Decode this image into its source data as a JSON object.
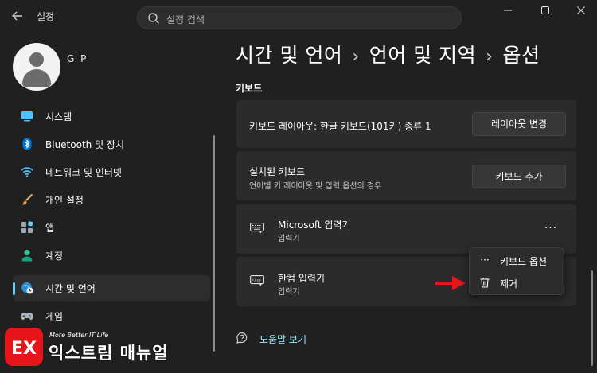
{
  "window": {
    "app_title": "설정",
    "back_icon": "back-arrow-icon",
    "controls": [
      "minimize-icon",
      "maximize-icon",
      "close-icon"
    ]
  },
  "search": {
    "placeholder": "설정 검색",
    "icon": "search-icon"
  },
  "user": {
    "name": "G P"
  },
  "sidebar": {
    "items": [
      {
        "label": "시스템",
        "icon": "system-icon",
        "selected": false
      },
      {
        "label": "Bluetooth 및 장치",
        "icon": "bluetooth-icon",
        "selected": false
      },
      {
        "label": "네트워크 및 인터넷",
        "icon": "wifi-icon",
        "selected": false
      },
      {
        "label": "개인 설정",
        "icon": "brush-icon",
        "selected": false
      },
      {
        "label": "앱",
        "icon": "apps-icon",
        "selected": false
      },
      {
        "label": "계정",
        "icon": "account-icon",
        "selected": false
      },
      {
        "label": "시간 및 언어",
        "icon": "globe-clock-icon",
        "selected": true
      },
      {
        "label": "게임",
        "icon": "gamepad-icon",
        "selected": false
      }
    ]
  },
  "breadcrumb": {
    "part1": "시간 및 언어",
    "part2": "언어 및 지역",
    "part3": "옵션",
    "separator": "›"
  },
  "section": {
    "title": "키보드"
  },
  "cards": {
    "layout": {
      "label": "키보드 레이아웃: 한글 키보드(101키) 종류 1",
      "button": "레이아웃 변경"
    },
    "installed": {
      "label": "설치된 키보드",
      "sub": "언어별 키 레이아웃 및 입력 옵션의 경우",
      "button": "키보드 추가"
    },
    "microsoft_ime": {
      "label": "Microsoft 입력기",
      "sub": "입력기",
      "more": "···"
    },
    "hancom_ime": {
      "label": "한컴 입력기",
      "sub": "입력기"
    }
  },
  "context_menu": {
    "items": [
      {
        "label": "키보드 옵션",
        "icon": "more-icon",
        "glyph": "···"
      },
      {
        "label": "제거",
        "icon": "trash-icon"
      }
    ]
  },
  "help": {
    "label": "도움말 보기"
  },
  "watermark": {
    "sub": "More Better IT Life",
    "main": "익스트림 매뉴얼",
    "logo_text": "EX"
  },
  "colors": {
    "accent": "#60cdff",
    "link": "#99ebff",
    "arrow": "#e8141c",
    "background": "#202020",
    "card": "#2b2b2b"
  }
}
